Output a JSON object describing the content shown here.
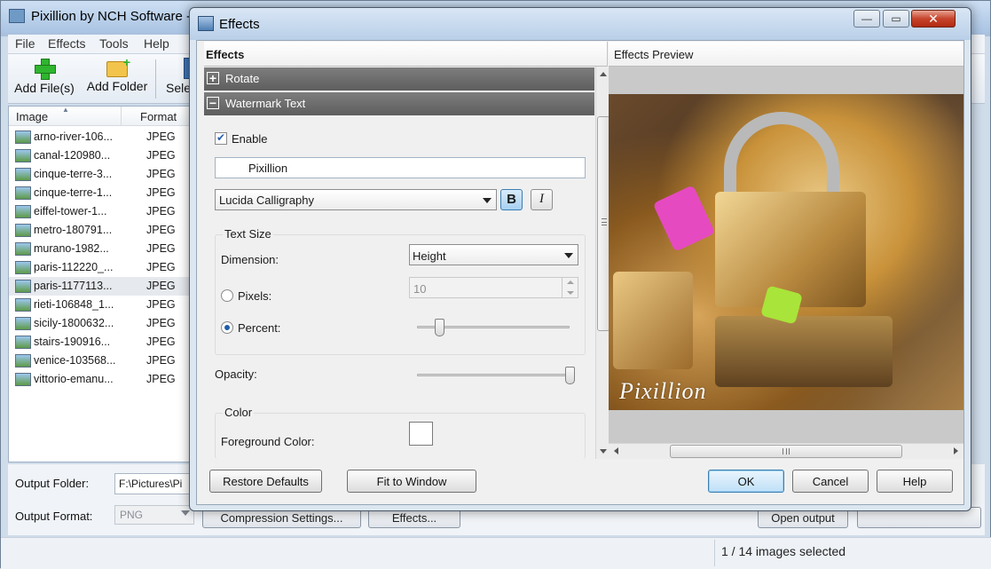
{
  "main": {
    "title": "Pixillion by NCH Software -",
    "menu": [
      "File",
      "Effects",
      "Tools",
      "Help"
    ],
    "toolbar": {
      "add_files": "Add File(s)",
      "add_folder": "Add Folder",
      "select": "Sele"
    },
    "file_list": {
      "col_image": "Image",
      "col_format": "Format",
      "rows": [
        {
          "name": "arno-river-106...",
          "format": "JPEG"
        },
        {
          "name": "canal-120980...",
          "format": "JPEG"
        },
        {
          "name": "cinque-terre-3...",
          "format": "JPEG"
        },
        {
          "name": "cinque-terre-1...",
          "format": "JPEG"
        },
        {
          "name": "eiffel-tower-1...",
          "format": "JPEG"
        },
        {
          "name": "metro-180791...",
          "format": "JPEG"
        },
        {
          "name": "murano-1982...",
          "format": "JPEG"
        },
        {
          "name": "paris-112220_...",
          "format": "JPEG"
        },
        {
          "name": "paris-1177113...",
          "format": "JPEG",
          "selected": true
        },
        {
          "name": "rieti-106848_1...",
          "format": "JPEG"
        },
        {
          "name": "sicily-1800632...",
          "format": "JPEG"
        },
        {
          "name": "stairs-190916...",
          "format": "JPEG"
        },
        {
          "name": "venice-103568...",
          "format": "JPEG"
        },
        {
          "name": "vittorio-emanu...",
          "format": "JPEG"
        }
      ]
    },
    "bottom": {
      "output_folder_label": "Output Folder:",
      "output_folder_value": "F:\\Pictures\\Pi",
      "output_format_label": "Output Format:",
      "output_format_value": "PNG",
      "compression_button": "Compression Settings...",
      "effects_button": "Effects...",
      "open_output_button": "Open output"
    },
    "status": "1 / 14 images selected"
  },
  "dialog": {
    "title": "Effects",
    "controls": {
      "minimize": "—",
      "maximize": "▭",
      "close": "✕"
    },
    "effects_header": "Effects",
    "preview_header": "Effects Preview",
    "sections": {
      "rotate": {
        "label": "Rotate",
        "state": "+"
      },
      "watermark": {
        "label": "Watermark Text",
        "state": "−"
      }
    },
    "enable_label": "Enable",
    "enable_checked": true,
    "watermark_text": "Pixillion",
    "font": "Lucida Calligraphy",
    "bold_label": "B",
    "italic_label": "I",
    "bold_active": true,
    "text_size": {
      "group_title": "Text Size",
      "dimension_label": "Dimension:",
      "dimension_value": "Height",
      "pixels_label": "Pixels:",
      "pixels_value": "10",
      "percent_label": "Percent:",
      "selected_mode": "Percent",
      "percent_slider_level": 0.12
    },
    "opacity": {
      "label": "Opacity:",
      "slider_level": 1.0
    },
    "color": {
      "group_title": "Color",
      "foreground_label": "Foreground Color:",
      "foreground_value": "#ffffff"
    },
    "preview_watermark": "Pixillion",
    "buttons": {
      "restore": "Restore Defaults",
      "fit": "Fit to Window",
      "ok": "OK",
      "cancel": "Cancel",
      "help": "Help"
    }
  }
}
